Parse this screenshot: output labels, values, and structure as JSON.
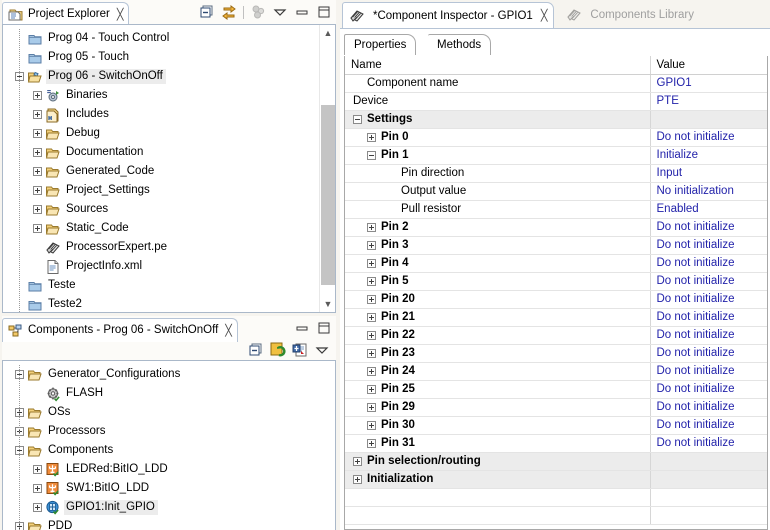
{
  "projectExplorer": {
    "tab_label": "Project Explorer",
    "close_label": "╳",
    "tools": [
      "collapse-all-icon",
      "link-with-editor-icon",
      "filter-icon",
      "view-menu-icon",
      "minimize-icon",
      "maximize-icon"
    ],
    "tree": [
      {
        "label": "Prog 04 - Touch Control",
        "depth": 1,
        "twist": "none",
        "icon": "closed-project-icon",
        "selected": false
      },
      {
        "label": "Prog 05 - Touch",
        "depth": 1,
        "twist": "none",
        "icon": "closed-project-icon",
        "selected": false
      },
      {
        "label": "Prog 06 - SwitchOnOff",
        "depth": 1,
        "twist": "minus",
        "icon": "open-project-icon",
        "selected": true
      },
      {
        "label": "Binaries",
        "depth": 2,
        "twist": "plus",
        "icon": "binaries-icon",
        "selected": false
      },
      {
        "label": "Includes",
        "depth": 2,
        "twist": "plus",
        "icon": "includes-icon",
        "selected": false
      },
      {
        "label": "Debug",
        "depth": 2,
        "twist": "plus",
        "icon": "folder-icon",
        "selected": false
      },
      {
        "label": "Documentation",
        "depth": 2,
        "twist": "plus",
        "icon": "folder-icon",
        "selected": false
      },
      {
        "label": "Generated_Code",
        "depth": 2,
        "twist": "plus",
        "icon": "folder-icon",
        "selected": false
      },
      {
        "label": "Project_Settings",
        "depth": 2,
        "twist": "plus",
        "icon": "folder-icon",
        "selected": false
      },
      {
        "label": "Sources",
        "depth": 2,
        "twist": "plus",
        "icon": "folder-icon",
        "selected": false
      },
      {
        "label": "Static_Code",
        "depth": 2,
        "twist": "plus",
        "icon": "folder-icon",
        "selected": false
      },
      {
        "label": "ProcessorExpert.pe",
        "depth": 2,
        "twist": "none",
        "icon": "processor-expert-icon",
        "selected": false
      },
      {
        "label": "ProjectInfo.xml",
        "depth": 2,
        "twist": "none",
        "icon": "xml-file-icon",
        "selected": false
      },
      {
        "label": "Teste",
        "depth": 1,
        "twist": "none",
        "icon": "closed-project-icon",
        "selected": false
      },
      {
        "label": "Teste2",
        "depth": 1,
        "twist": "none",
        "icon": "closed-project-icon",
        "selected": false
      }
    ]
  },
  "componentsView": {
    "tab_label": "Components - Prog 06 - SwitchOnOff",
    "close_label": "╳",
    "header_tools": [
      "minimize-icon",
      "maximize-icon"
    ],
    "toolbar_tools": [
      "collapse-all-icon",
      "generate-code-icon",
      "import-component-icon",
      "view-menu-icon"
    ],
    "tree": [
      {
        "label": "Generator_Configurations",
        "depth": 1,
        "twist": "minus",
        "icon": "folder-icon",
        "selected": false
      },
      {
        "label": "FLASH",
        "depth": 2,
        "twist": "none",
        "icon": "gear-icon",
        "selected": false
      },
      {
        "label": "OSs",
        "depth": 1,
        "twist": "plus",
        "icon": "folder-icon",
        "selected": false
      },
      {
        "label": "Processors",
        "depth": 1,
        "twist": "plus",
        "icon": "folder-icon",
        "selected": false
      },
      {
        "label": "Components",
        "depth": 1,
        "twist": "minus",
        "icon": "folder-icon",
        "selected": false
      },
      {
        "label": "LEDRed:BitIO_LDD",
        "depth": 2,
        "twist": "plus",
        "icon": "component-icon",
        "selected": false
      },
      {
        "label": "SW1:BitIO_LDD",
        "depth": 2,
        "twist": "plus",
        "icon": "component-icon",
        "selected": false
      },
      {
        "label": "GPIO1:Init_GPIO",
        "depth": 2,
        "twist": "plus",
        "icon": "init-component-icon",
        "selected": true
      },
      {
        "label": "PDD",
        "depth": 1,
        "twist": "plus",
        "icon": "folder-icon",
        "selected": false
      }
    ]
  },
  "inspector": {
    "editor_tabs": [
      {
        "label": "*Component Inspector - GPIO1",
        "active": true,
        "icon": "processor-expert-icon",
        "close_label": "╳"
      },
      {
        "label": "Components Library",
        "active": false,
        "icon": "processor-expert-icon",
        "close_label": ""
      }
    ],
    "property_tabs": [
      {
        "label": "Properties",
        "active": true
      },
      {
        "label": "Methods",
        "active": false
      }
    ],
    "columns": [
      "Name",
      "Value"
    ],
    "rows": [
      {
        "name": "Component name",
        "value": "GPIO1",
        "indent": 1,
        "twist": "none",
        "kind": "prop"
      },
      {
        "name": "Device",
        "value": "PTE",
        "indent": 0,
        "twist": "none",
        "kind": "prop"
      },
      {
        "name": "Settings",
        "value": "",
        "indent": 0,
        "twist": "minus",
        "kind": "cat"
      },
      {
        "name": "Pin 0",
        "value": "Do not initialize",
        "indent": 1,
        "twist": "plus",
        "kind": "pin"
      },
      {
        "name": "Pin 1",
        "value": "Initialize",
        "indent": 1,
        "twist": "minus",
        "kind": "pin"
      },
      {
        "name": "Pin direction",
        "value": "Input",
        "indent": 3,
        "twist": "none",
        "kind": "prop"
      },
      {
        "name": "Output value",
        "value": "No initialization",
        "indent": 3,
        "twist": "none",
        "kind": "prop"
      },
      {
        "name": "Pull resistor",
        "value": "Enabled",
        "indent": 3,
        "twist": "none",
        "kind": "prop"
      },
      {
        "name": "Pin 2",
        "value": "Do not initialize",
        "indent": 1,
        "twist": "plus",
        "kind": "pin"
      },
      {
        "name": "Pin 3",
        "value": "Do not initialize",
        "indent": 1,
        "twist": "plus",
        "kind": "pin"
      },
      {
        "name": "Pin 4",
        "value": "Do not initialize",
        "indent": 1,
        "twist": "plus",
        "kind": "pin"
      },
      {
        "name": "Pin 5",
        "value": "Do not initialize",
        "indent": 1,
        "twist": "plus",
        "kind": "pin"
      },
      {
        "name": "Pin 20",
        "value": "Do not initialize",
        "indent": 1,
        "twist": "plus",
        "kind": "pin"
      },
      {
        "name": "Pin 21",
        "value": "Do not initialize",
        "indent": 1,
        "twist": "plus",
        "kind": "pin"
      },
      {
        "name": "Pin 22",
        "value": "Do not initialize",
        "indent": 1,
        "twist": "plus",
        "kind": "pin"
      },
      {
        "name": "Pin 23",
        "value": "Do not initialize",
        "indent": 1,
        "twist": "plus",
        "kind": "pin"
      },
      {
        "name": "Pin 24",
        "value": "Do not initialize",
        "indent": 1,
        "twist": "plus",
        "kind": "pin"
      },
      {
        "name": "Pin 25",
        "value": "Do not initialize",
        "indent": 1,
        "twist": "plus",
        "kind": "pin"
      },
      {
        "name": "Pin 29",
        "value": "Do not initialize",
        "indent": 1,
        "twist": "plus",
        "kind": "pin"
      },
      {
        "name": "Pin 30",
        "value": "Do not initialize",
        "indent": 1,
        "twist": "plus",
        "kind": "pin"
      },
      {
        "name": "Pin 31",
        "value": "Do not initialize",
        "indent": 1,
        "twist": "plus",
        "kind": "pin"
      },
      {
        "name": "Pin selection/routing",
        "value": "",
        "indent": 0,
        "twist": "plus",
        "kind": "cat"
      },
      {
        "name": "Initialization",
        "value": "",
        "indent": 0,
        "twist": "plus",
        "kind": "cat"
      },
      {
        "name": "",
        "value": "",
        "indent": 0,
        "twist": "none",
        "kind": "blank"
      },
      {
        "name": "",
        "value": "",
        "indent": 0,
        "twist": "none",
        "kind": "blank"
      }
    ]
  },
  "colors": {
    "value_text": "#2222aa",
    "category_row": "#ececec",
    "selection": "#ececec",
    "frame": "#aab8c9",
    "panel_bg": "#f6f4ef"
  },
  "scrollbar": {
    "up_glyph": "▲",
    "down_glyph": "▼"
  }
}
